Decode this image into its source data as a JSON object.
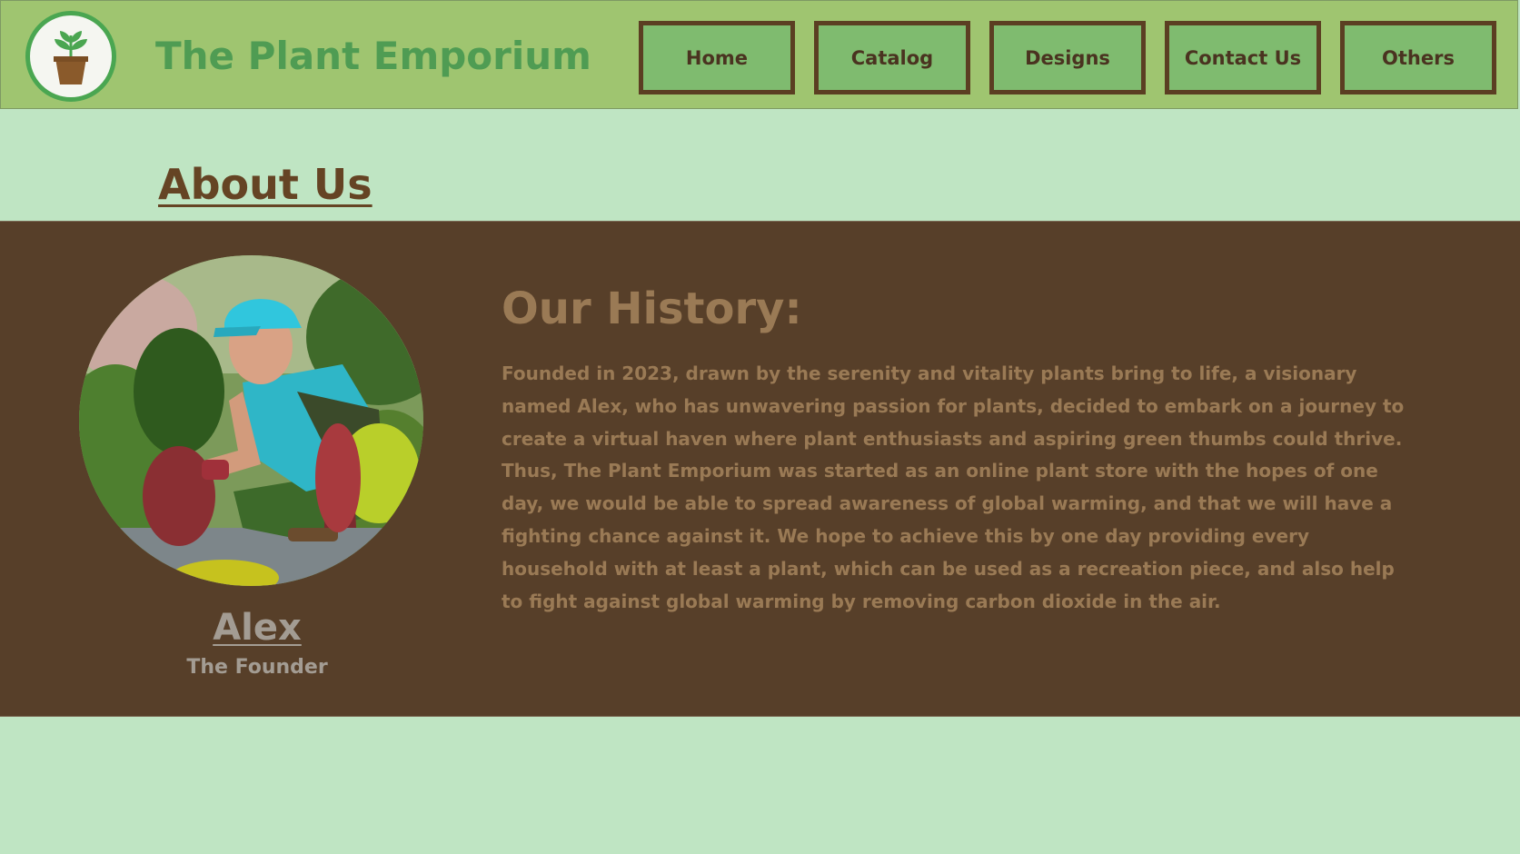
{
  "header": {
    "logo_icon": "potted-plant-icon",
    "site_title": "The Plant Emporium",
    "nav": [
      {
        "label": "Home"
      },
      {
        "label": "Catalog"
      },
      {
        "label": "Designs"
      },
      {
        "label": "Contact Us"
      },
      {
        "label": "Others"
      }
    ]
  },
  "about": {
    "heading": "About Us"
  },
  "founder": {
    "photo": "gardener-photo",
    "name": "Alex",
    "role": "The Founder"
  },
  "history": {
    "heading": "Our History:",
    "body": "Founded in 2023, drawn by the serenity and vitality plants bring to life, a visionary named Alex, who has unwavering passion for plants, decided to embark on a journey to create a virtual haven where plant enthusiasts and aspiring green thumbs could thrive. Thus, The Plant Emporium was started as an online plant store with the hopes of one day, we would be able to spread awareness of global warming, and that we will have a fighting chance against it. We hope to achieve this by one day providing every household with at least a plant, which can be used as a recreation piece, and also help to fight against global warming by removing carbon dioxide in the air."
  },
  "colors": {
    "page_bg": "#bfe5c3",
    "header_bg": "#9fc570",
    "title_green": "#4f9c53",
    "nav_bg": "#7fbb6f",
    "nav_border": "#5b3e22",
    "panel_bg": "#573f29",
    "history_text": "#9a7a55",
    "founder_text": "#a39c93"
  }
}
